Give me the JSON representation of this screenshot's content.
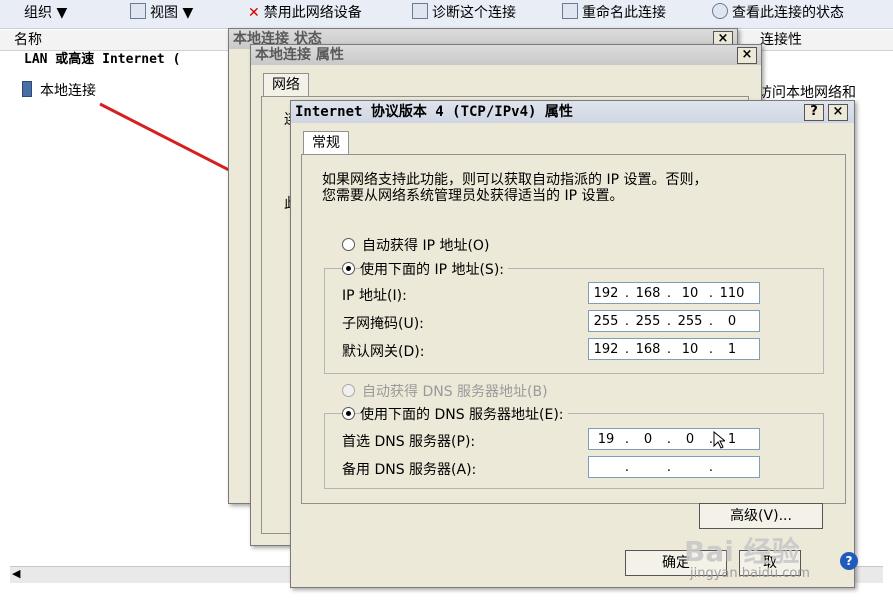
{
  "toolbar": {
    "organize": "组织 ▼",
    "view": "视图 ▼",
    "disable": "禁用此网络设备",
    "diagnose": "诊断这个连接",
    "rename": "重命名此连接",
    "status": "查看此连接的状态"
  },
  "list": {
    "col_name": "名称",
    "col_conn": "连接性",
    "group_label": "LAN 或高速 Internet (",
    "connection": "本地连接",
    "right_text": "访问本地网络和"
  },
  "status_dialog": {
    "title": "本地连接 状态",
    "close": "×"
  },
  "props_dialog": {
    "title": "本地连接 属性",
    "close": "×",
    "tab": "网络",
    "frag1": "连",
    "frag2": "此"
  },
  "ipv4_dialog": {
    "title": "Internet 协议版本 4 (TCP/IPv4) 属性",
    "help": "?",
    "close": "×",
    "tab": "常规",
    "desc_line1": "如果网络支持此功能，则可以获取自动指派的 IP 设置。否则，",
    "desc_line2": "您需要从网络系统管理员处获得适当的 IP 设置。",
    "auto_ip": "自动获得 IP 地址(O)",
    "use_ip": "使用下面的 IP 地址(S):",
    "ip_label": "IP 地址(I):",
    "mask_label": "子网掩码(U):",
    "gw_label": "默认网关(D):",
    "ip": [
      "192",
      "168",
      "10",
      "110"
    ],
    "mask": [
      "255",
      "255",
      "255",
      "0"
    ],
    "gw": [
      "192",
      "168",
      "10",
      "1"
    ],
    "auto_dns": "自动获得 DNS 服务器地址(B)",
    "use_dns": "使用下面的 DNS 服务器地址(E):",
    "pref_dns_label": "首选 DNS 服务器(P):",
    "alt_dns_label": "备用 DNS 服务器(A):",
    "pref_dns": [
      "19",
      "0",
      "0",
      "1"
    ],
    "alt_dns": [
      "",
      "",
      "",
      ""
    ],
    "advanced": "高级(V)...",
    "ok": "确定",
    "cancel": "取"
  },
  "watermark": {
    "brand": "Bai 经验",
    "url": "jingyan.baidu.com"
  },
  "colors": {
    "arrow": "#d42020",
    "window_bg": "#ece9d8"
  }
}
